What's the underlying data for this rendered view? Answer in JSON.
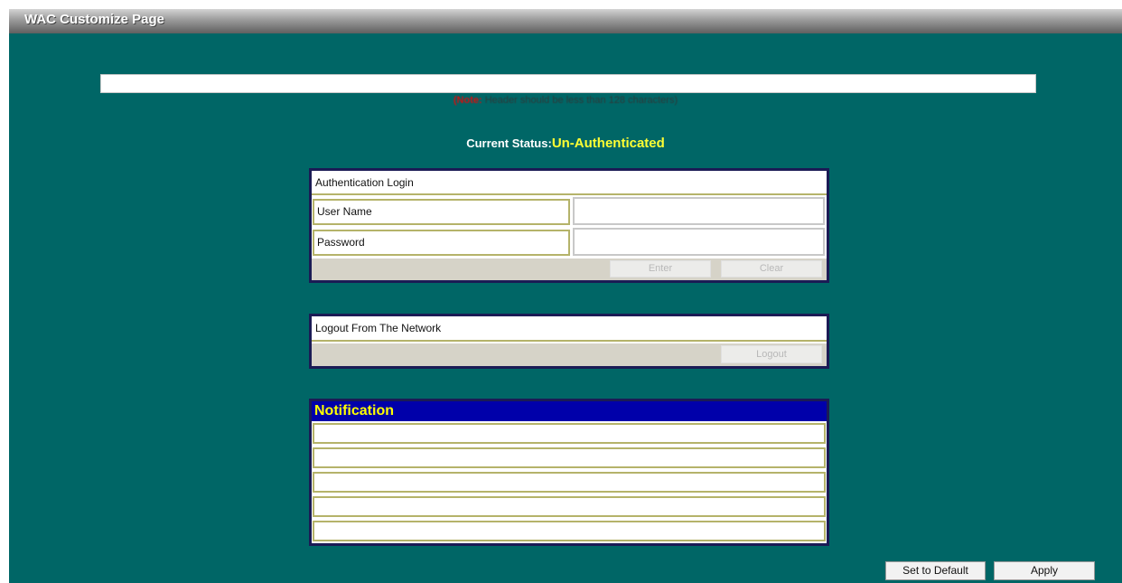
{
  "window": {
    "title": "WAC Customize Page"
  },
  "header": {
    "input_value": "",
    "note_label": "(Note:",
    "note_text": "Header should be less than 128 characters)"
  },
  "status": {
    "label": "Current Status:",
    "value": "Un-Authenticated"
  },
  "auth_panel": {
    "title": "Authentication Login",
    "username_label": "User Name",
    "password_label": "Password",
    "enter_button": "Enter",
    "clear_button": "Clear"
  },
  "logout_panel": {
    "title": "Logout From The Network",
    "logout_button": "Logout"
  },
  "notification_panel": {
    "title": "Notification",
    "lines": [
      "",
      "",
      "",
      "",
      ""
    ]
  },
  "footer": {
    "set_default_button": "Set to Default",
    "apply_button": "Apply"
  },
  "colors": {
    "background": "#006666",
    "status_value": "#ffff33",
    "notification_header": "#0000aa",
    "notification_title": "#ffff00",
    "note_label": "#d01010"
  }
}
